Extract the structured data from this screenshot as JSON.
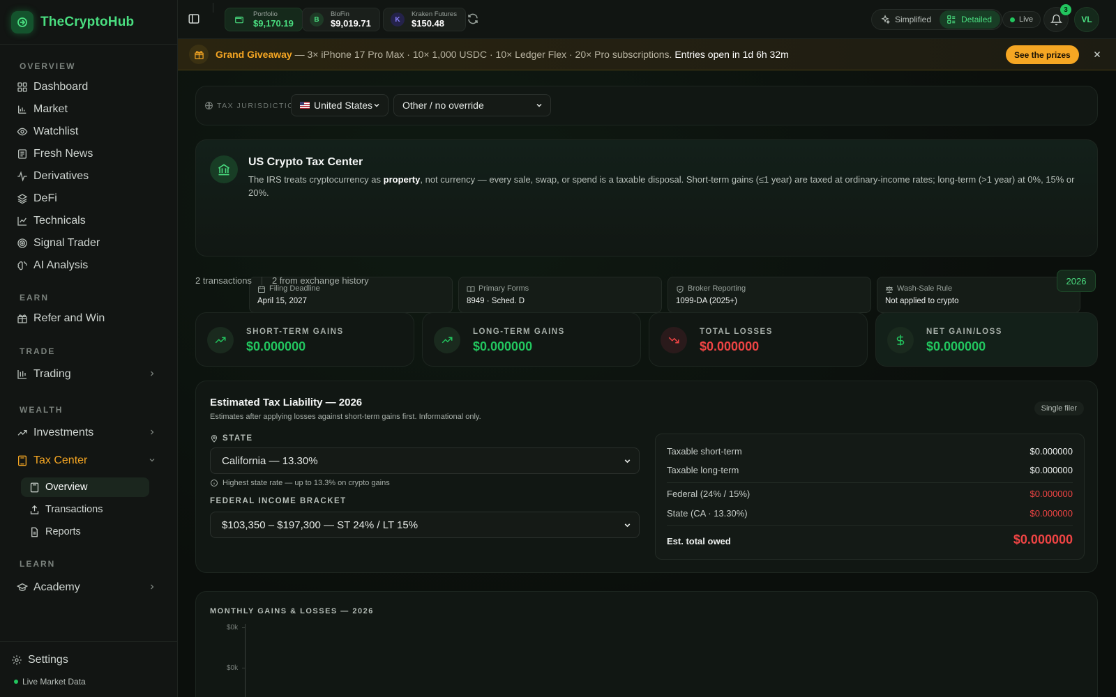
{
  "brand": {
    "name": "TheCryptoHub"
  },
  "sidebar": {
    "sections": [
      "OVERVIEW",
      "EARN",
      "TRADE",
      "WEALTH",
      "LEARN"
    ],
    "overview_items": [
      {
        "label": "Dashboard",
        "icon": "dashboard-icon"
      },
      {
        "label": "Market",
        "icon": "market-icon"
      },
      {
        "label": "Watchlist",
        "icon": "eye-icon"
      },
      {
        "label": "Fresh News",
        "icon": "news-icon"
      },
      {
        "label": "Derivatives",
        "icon": "pulse-icon"
      },
      {
        "label": "DeFi",
        "icon": "layers-icon"
      },
      {
        "label": "Technicals",
        "icon": "line-chart-icon"
      },
      {
        "label": "Signal Trader",
        "icon": "target-icon"
      },
      {
        "label": "AI Analysis",
        "icon": "brain-icon"
      }
    ],
    "earn_item": "Refer and Win",
    "trade_item": "Trading",
    "wealth_items": [
      "Investments",
      "Tax Center"
    ],
    "tax_sub_items": [
      "Overview",
      "Transactions",
      "Reports"
    ],
    "learn_item": "Academy",
    "settings": "Settings",
    "live_data": "Live Market Data"
  },
  "topbar": {
    "wallets": [
      {
        "label": "Portfolio",
        "value": "$9,170.19",
        "badge": ""
      },
      {
        "label": "BloFin",
        "value": "$9,019.71",
        "badge": "B"
      },
      {
        "label": "Kraken Futures",
        "value": "$150.48",
        "badge": "K"
      }
    ],
    "view_modes": [
      "Simplified",
      "Detailed"
    ],
    "active_mode": "Detailed",
    "live": "Live",
    "notifications": "3",
    "avatar": "VL"
  },
  "banner": {
    "title": "Grand Giveaway",
    "text": " — 3× iPhone 17 Pro Max · 10× 1,000 USDC · 10× Ledger Flex · 20× Pro subscriptions. ",
    "countdown": "Entries open in 1d 6h 32m",
    "cta": "See the prizes"
  },
  "jurisdiction": {
    "label": "TAX JURISDICTION",
    "country": "United States",
    "override": "Other / no override"
  },
  "tax_center": {
    "title": "US Crypto Tax Center",
    "desc_pre": "The IRS treats cryptocurrency as ",
    "desc_bold": "property",
    "desc_post": ", not currency — every sale, swap, or spend is a taxable disposal. Short-term gains (≤1 year) are taxed at ordinary-income rates; long-term (>1 year) at 0%, 15% or 20%.",
    "facts": [
      {
        "label": "Filing Deadline",
        "value": "April 15, 2027"
      },
      {
        "label": "Primary Forms",
        "value": "8949 · Sched. D"
      },
      {
        "label": "Broker Reporting",
        "value": "1099-DA (2025+)"
      },
      {
        "label": "Wash-Sale Rule",
        "value": "Not applied to crypto"
      }
    ]
  },
  "summary": {
    "transactions": "2 transactions",
    "source": "2 from exchange history",
    "year": "2026"
  },
  "kpis": [
    {
      "label": "SHORT-TERM GAINS",
      "value": "$0.000000",
      "color": "#22c55e"
    },
    {
      "label": "LONG-TERM GAINS",
      "value": "$0.000000",
      "color": "#22c55e"
    },
    {
      "label": "TOTAL LOSSES",
      "value": "$0.000000",
      "color": "#ef4444"
    },
    {
      "label": "NET GAIN/LOSS",
      "value": "$0.000000",
      "color": "#22c55e"
    }
  ],
  "liability": {
    "title": "Estimated Tax Liability — 2026",
    "subtitle": "Estimates after applying losses against short-term gains first. Informational only.",
    "filer": "Single filer",
    "state_label": "STATE",
    "state_value": "California — 13.30%",
    "state_hint": "Highest state rate — up to 13.3% on crypto gains",
    "bracket_label": "FEDERAL INCOME BRACKET",
    "bracket_value": "$103,350 – $197,300 — ST 24% / LT 15%",
    "rows": [
      {
        "label": "Taxable short-term",
        "value": "$0.000000"
      },
      {
        "label": "Taxable long-term",
        "value": "$0.000000"
      },
      {
        "label": "Federal (24% / 15%)",
        "value": "$0.000000"
      },
      {
        "label": "State (CA · 13.30%)",
        "value": "$0.000000"
      }
    ],
    "total_label": "Est. total owed",
    "total_value": "$0.000000"
  },
  "monthly_chart": {
    "title": "MONTHLY GAINS & LOSSES — 2026",
    "ticks": [
      "$0k",
      "$0k"
    ]
  }
}
